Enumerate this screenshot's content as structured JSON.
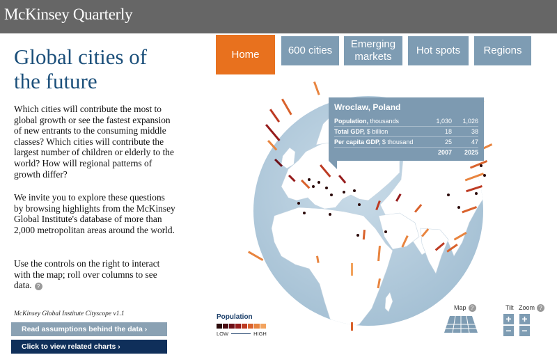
{
  "header": {
    "brand": "McKinsey Quarterly"
  },
  "left": {
    "title": "Global cities of the future",
    "paragraph1": "Which cities will contribute the most to global growth or see the fastest expansion of new entrants to the consuming middle classes? Which cities will contribute the largest number of children or elderly to the world? How will regional patterns of growth differ?",
    "paragraph2": "We invite you to explore these questions by browsing highlights from the McKinsey Global Institute's database of more than 2,000 metropolitan areas around the world.",
    "paragraph3": "Use the controls on the right to interact with the map; roll over columns to see data.",
    "help": "?",
    "version": "McKinsey Global Institute Cityscope v1.1",
    "assumptions_button": "Read assumptions behind the data ›",
    "charts_button": "Click to view related charts ›"
  },
  "tabs": [
    {
      "label": "Home",
      "active": true
    },
    {
      "label": "600 cities",
      "active": false
    },
    {
      "label": "Emerging markets",
      "active": false
    },
    {
      "label": "Hot spots",
      "active": false
    },
    {
      "label": "Regions",
      "active": false
    }
  ],
  "tooltip": {
    "city": "Wroclaw, Poland",
    "rows": [
      {
        "label": "Population,",
        "unit": "thousands",
        "v2007": "1,030",
        "v2025": "1,026"
      },
      {
        "label": "Total GDP,",
        "unit": "$ billion",
        "v2007": "18",
        "v2025": "38"
      },
      {
        "label": "Per capita GDP,",
        "unit": "$ thousand",
        "v2007": "25",
        "v2025": "47"
      }
    ],
    "year1": "2007",
    "year2": "2025"
  },
  "legend": {
    "title": "Population",
    "low": "LOW",
    "high": "HIGH",
    "colors": [
      "#2b0a0a",
      "#4a0d12",
      "#6e1018",
      "#961c1c",
      "#bd3b23",
      "#d9622c",
      "#e8843f",
      "#f2a35e"
    ]
  },
  "controls": {
    "map_label": "Map",
    "tilt_label": "Tilt",
    "zoom_label": "Zoom",
    "help": "?",
    "plus": "+",
    "minus": "−"
  },
  "colors": {
    "header_bg": "#666666",
    "title": "#1b4f7a",
    "tab": "#7e9cb3",
    "tab_active": "#e8711e",
    "ocean": "#b8cfdf",
    "land": "#ffffff"
  }
}
